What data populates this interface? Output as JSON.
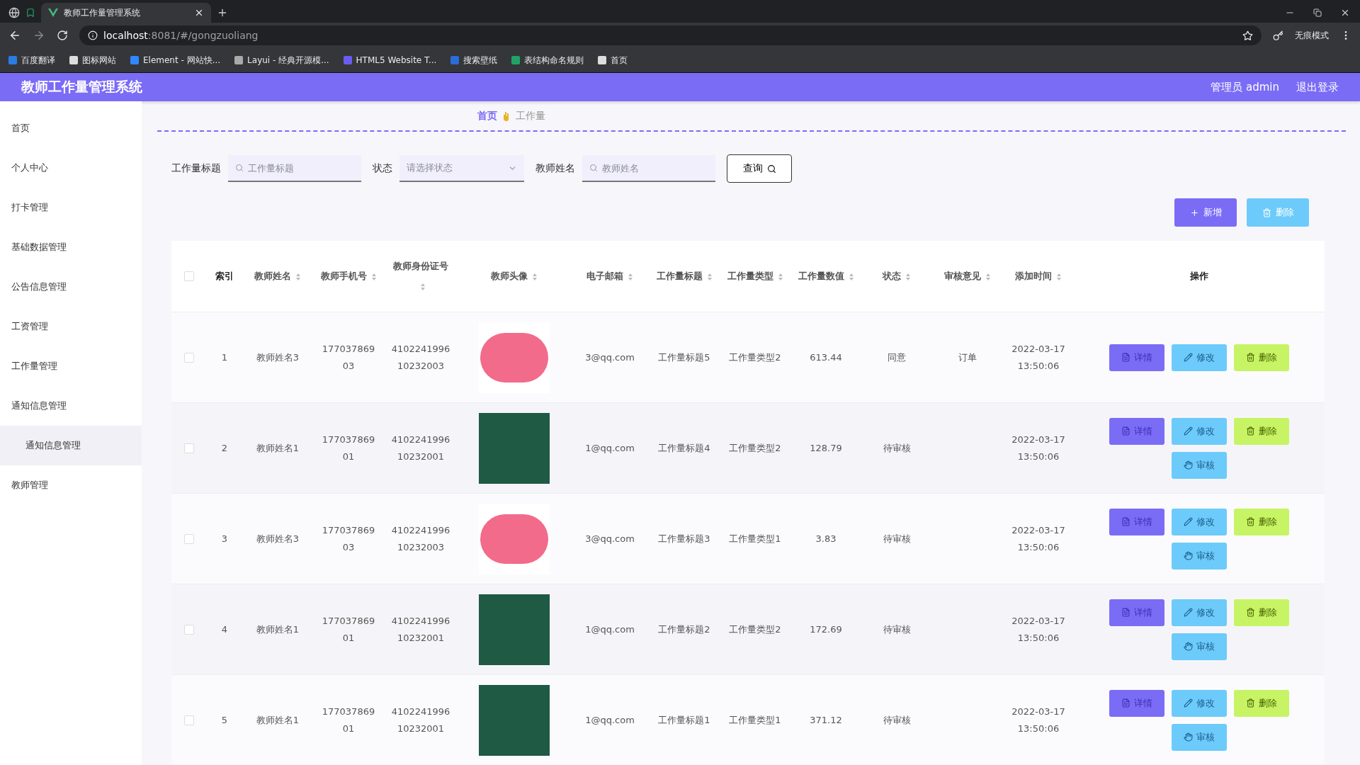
{
  "browser": {
    "tab_title": "教师工作量管理系统",
    "url_host": "localhost",
    "url_rest": ":8081/#/gongzuoliang",
    "profile": "无痕模式",
    "bookmarks": [
      "百度翻译",
      "图标网站",
      "Element - 网站快...",
      "Layui - 经典开源模...",
      "HTML5 Website T...",
      "搜索壁纸",
      "表结构命名规则",
      "首页"
    ]
  },
  "header": {
    "title": "教师工作量管理系统",
    "user": "管理员 admin",
    "logout": "退出登录"
  },
  "sidebar": {
    "items": [
      {
        "label": "首页",
        "selected": false
      },
      {
        "label": "个人中心",
        "selected": false
      },
      {
        "label": "打卡管理",
        "selected": false
      },
      {
        "label": "基础数据管理",
        "selected": false
      },
      {
        "label": "公告信息管理",
        "selected": false
      },
      {
        "label": "工资管理",
        "selected": false
      },
      {
        "label": "工作量管理",
        "selected": false
      },
      {
        "label": "通知信息管理",
        "selected": false,
        "children": [
          {
            "label": "通知信息管理",
            "selected": true
          }
        ]
      },
      {
        "label": "教师管理",
        "selected": false
      }
    ]
  },
  "breadcrumb": [
    "首页",
    "工作量"
  ],
  "filters": [
    {
      "kind": "input",
      "label": "工作量标题",
      "placeholder": "工作量标题"
    },
    {
      "kind": "select",
      "label": "状态",
      "placeholder": "请选择状态"
    },
    {
      "kind": "input",
      "label": "教师姓名",
      "placeholder": "教师姓名"
    }
  ],
  "search_button": "查询",
  "toolbar": [
    {
      "kind": "add",
      "label": "新增"
    },
    {
      "kind": "delete",
      "label": "删除"
    }
  ],
  "table": {
    "select_all": {
      "checked": false
    },
    "columns": [
      {
        "label": "索引",
        "sortable": false
      },
      {
        "label": "教师姓名",
        "sortable": true
      },
      {
        "label": "教师手机号",
        "sortable": true
      },
      {
        "label": "教师身份证号",
        "sortable": true
      },
      {
        "label": "教师头像",
        "sortable": true
      },
      {
        "label": "电子邮箱",
        "sortable": true
      },
      {
        "label": "工作量标题",
        "sortable": true
      },
      {
        "label": "工作量类型",
        "sortable": true
      },
      {
        "label": "工作量数值",
        "sortable": true
      },
      {
        "label": "状态",
        "sortable": true
      },
      {
        "label": "审核意见",
        "sortable": true
      },
      {
        "label": "添加时间",
        "sortable": true
      },
      {
        "label": "操作",
        "sortable": false
      }
    ],
    "rows": [
      {
        "checked": false,
        "index": "1",
        "name": "教师姓名3",
        "phone": "17703786903",
        "id_number": "410224199610232003",
        "avatar": {
          "kind": "girl"
        },
        "email": "3@qq.com",
        "title": "工作量标题5",
        "type": "工作量类型2",
        "value": "613.44",
        "status": "同意",
        "opinion": "订单",
        "time": "2022-03-17 13:50:06",
        "actions": [
          {
            "kind": "detail",
            "label": "详情"
          },
          {
            "kind": "edit",
            "label": "修改"
          },
          {
            "kind": "delete",
            "label": "删除"
          }
        ]
      },
      {
        "checked": false,
        "index": "2",
        "name": "教师姓名1",
        "phone": "17703786901",
        "id_number": "410224199610232001",
        "avatar": {
          "kind": "teacher"
        },
        "email": "1@qq.com",
        "title": "工作量标题4",
        "type": "工作量类型2",
        "value": "128.79",
        "status": "待审核",
        "time": "2022-03-17 13:50:06",
        "actions": [
          {
            "kind": "detail",
            "label": "详情"
          },
          {
            "kind": "edit",
            "label": "修改"
          },
          {
            "kind": "delete",
            "label": "删除"
          },
          {
            "kind": "review",
            "label": "审核"
          }
        ]
      },
      {
        "checked": false,
        "index": "3",
        "name": "教师姓名3",
        "phone": "17703786903",
        "id_number": "410224199610232003",
        "avatar": {
          "kind": "girl"
        },
        "email": "3@qq.com",
        "title": "工作量标题3",
        "type": "工作量类型1",
        "value": "3.83",
        "status": "待审核",
        "time": "2022-03-17 13:50:06",
        "actions": [
          {
            "kind": "detail",
            "label": "详情"
          },
          {
            "kind": "edit",
            "label": "修改"
          },
          {
            "kind": "delete",
            "label": "删除"
          },
          {
            "kind": "review",
            "label": "审核"
          }
        ]
      },
      {
        "checked": false,
        "index": "4",
        "name": "教师姓名1",
        "phone": "17703786901",
        "id_number": "410224199610232001",
        "avatar": {
          "kind": "teacher"
        },
        "email": "1@qq.com",
        "title": "工作量标题2",
        "type": "工作量类型2",
        "value": "172.69",
        "status": "待审核",
        "time": "2022-03-17 13:50:06",
        "actions": [
          {
            "kind": "detail",
            "label": "详情"
          },
          {
            "kind": "edit",
            "label": "修改"
          },
          {
            "kind": "delete",
            "label": "删除"
          },
          {
            "kind": "review",
            "label": "审核"
          }
        ]
      },
      {
        "checked": false,
        "index": "5",
        "name": "教师姓名1",
        "phone": "17703786901",
        "id_number": "410224199610232001",
        "avatar": {
          "kind": "teacher"
        },
        "email": "1@qq.com",
        "title": "工作量标题1",
        "type": "工作量类型1",
        "value": "371.12",
        "status": "待审核",
        "time": "2022-03-17 13:50:06",
        "actions": [
          {
            "kind": "detail",
            "label": "详情"
          },
          {
            "kind": "edit",
            "label": "修改"
          },
          {
            "kind": "delete",
            "label": "删除"
          },
          {
            "kind": "review",
            "label": "审核"
          }
        ]
      }
    ]
  }
}
